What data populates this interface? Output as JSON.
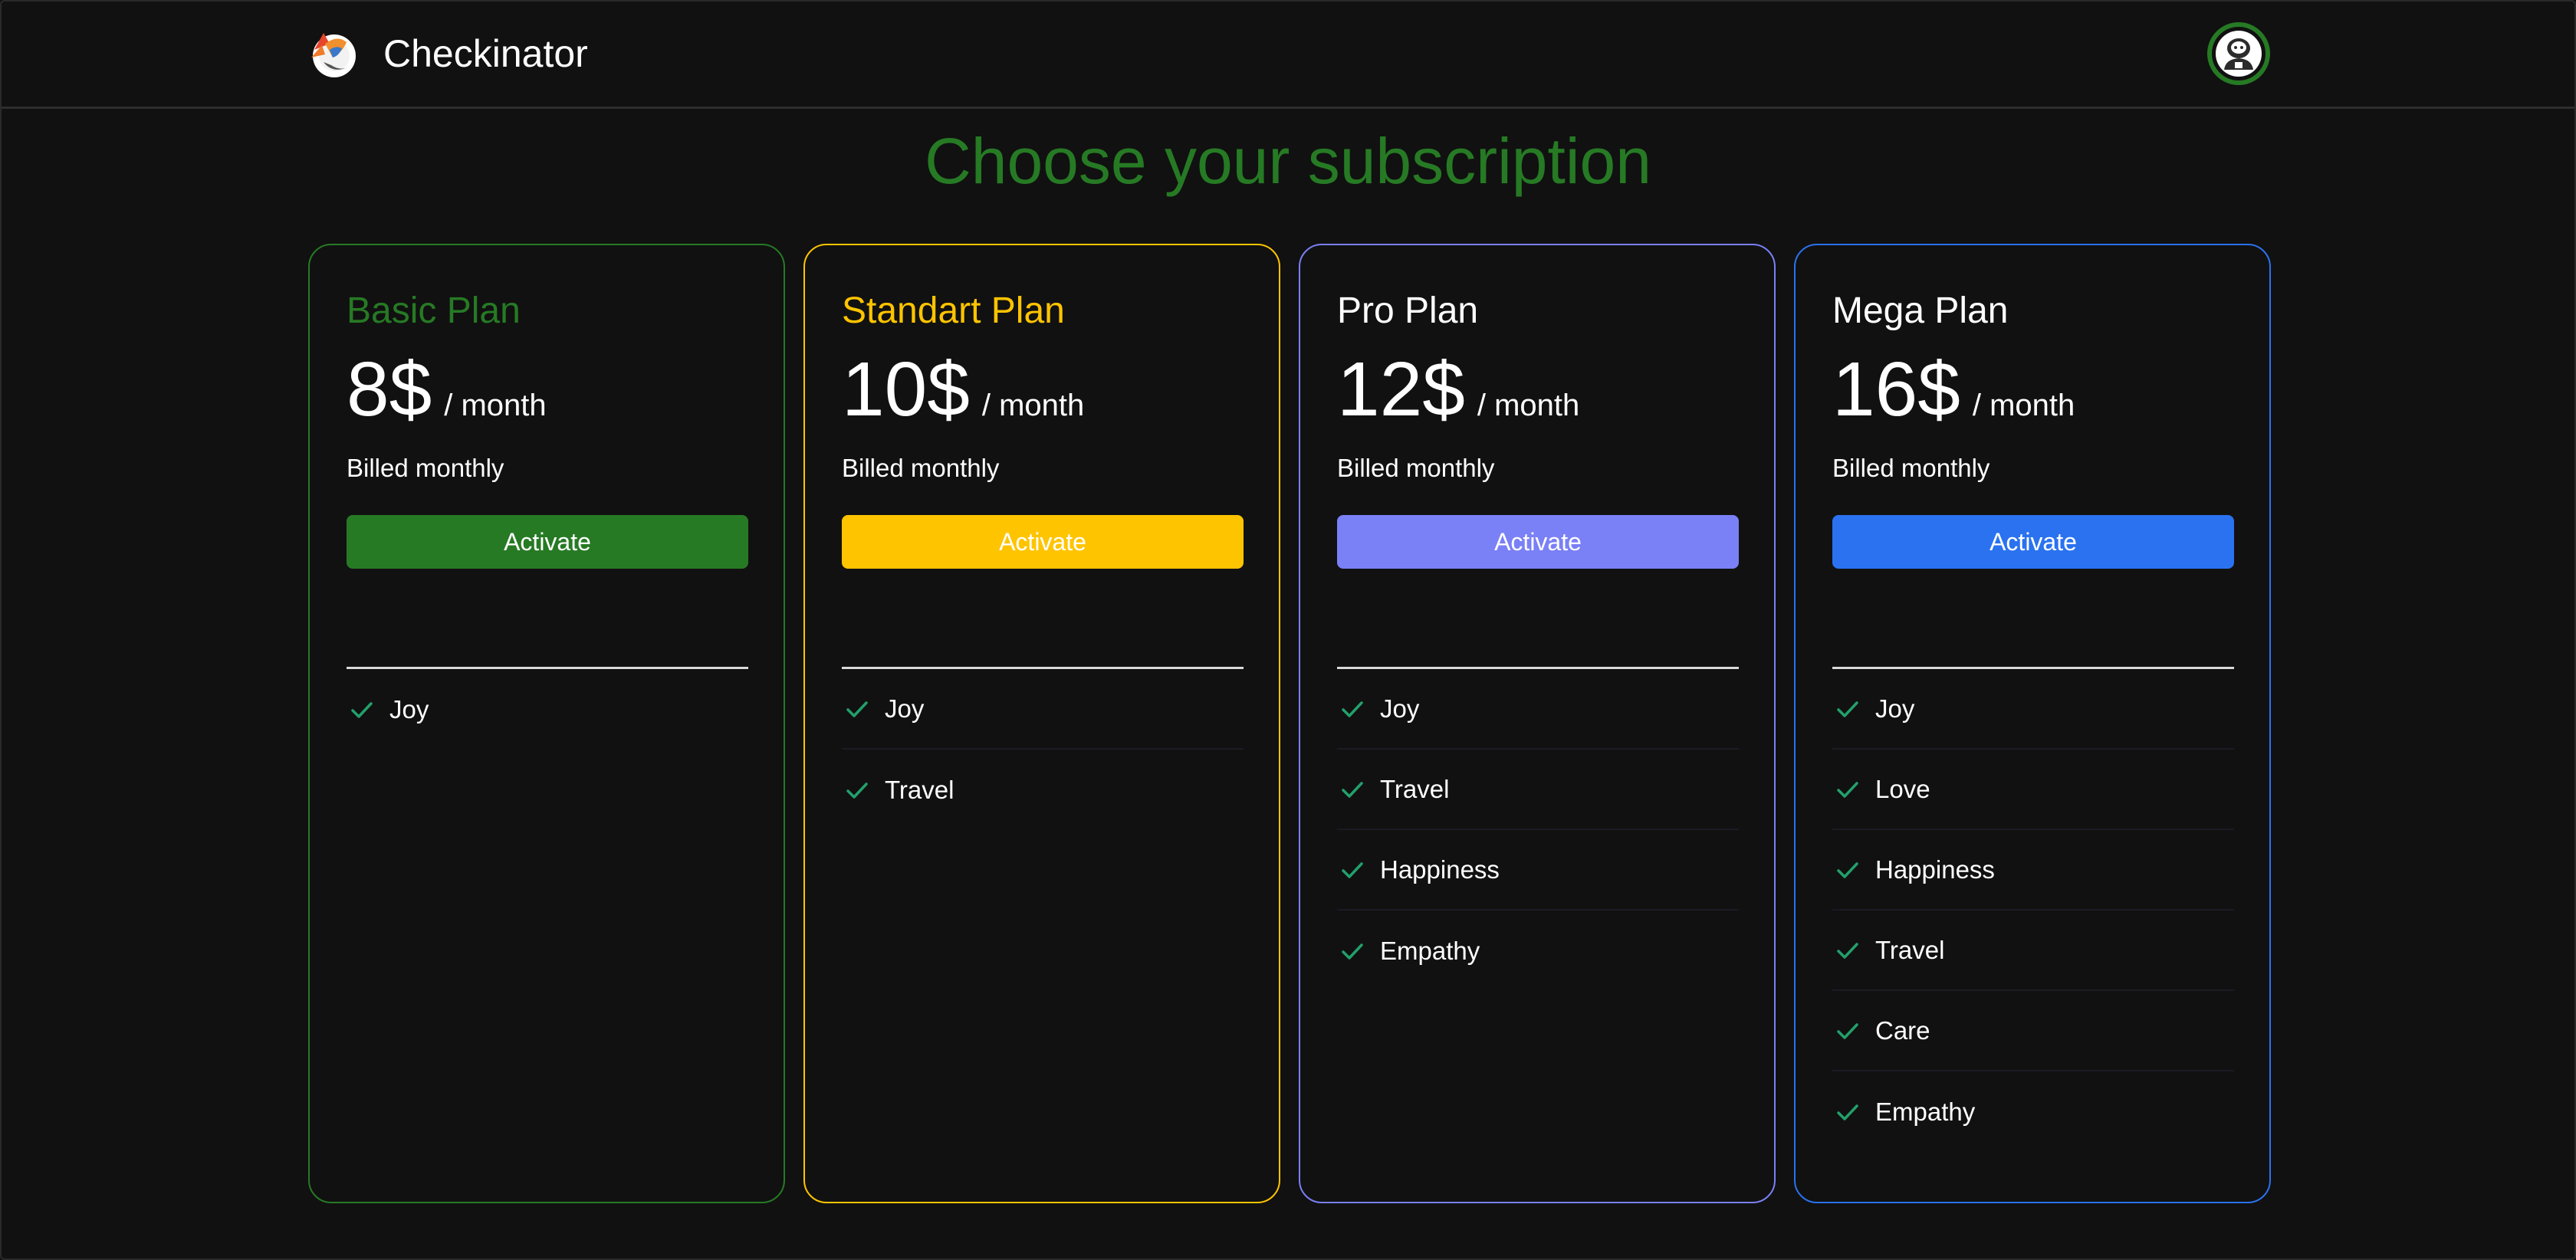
{
  "header": {
    "app_name": "Checkinator",
    "logo_icon": "rocket-logo-icon",
    "avatar_icon": "astronaut-avatar-icon"
  },
  "page_title": "Choose your subscription",
  "colors": {
    "background": "#111111",
    "title_green": "#267a24",
    "check_green": "#22a06b"
  },
  "plans": [
    {
      "name": "Basic Plan",
      "price": "8$",
      "period": "/ month",
      "billing": "Billed monthly",
      "button_label": "Activate",
      "accent": "#267a24",
      "name_color": "#267a24",
      "features": [
        "Joy"
      ]
    },
    {
      "name": "Standart Plan",
      "price": "10$",
      "period": "/ month",
      "billing": "Billed monthly",
      "button_label": "Activate",
      "accent": "#ffc400",
      "name_color": "#ffc400",
      "features": [
        "Joy",
        "Travel"
      ]
    },
    {
      "name": "Pro Plan",
      "price": "12$",
      "period": "/ month",
      "billing": "Billed monthly",
      "button_label": "Activate",
      "accent": "#7a80f5",
      "name_color": "#ffffff",
      "features": [
        "Joy",
        "Travel",
        "Happiness",
        "Empathy"
      ]
    },
    {
      "name": "Mega Plan",
      "price": "16$",
      "period": "/ month",
      "billing": "Billed monthly",
      "button_label": "Activate",
      "accent": "#2a72f0",
      "name_color": "#ffffff",
      "features": [
        "Joy",
        "Love",
        "Happiness",
        "Travel",
        "Care",
        "Empathy"
      ]
    }
  ]
}
